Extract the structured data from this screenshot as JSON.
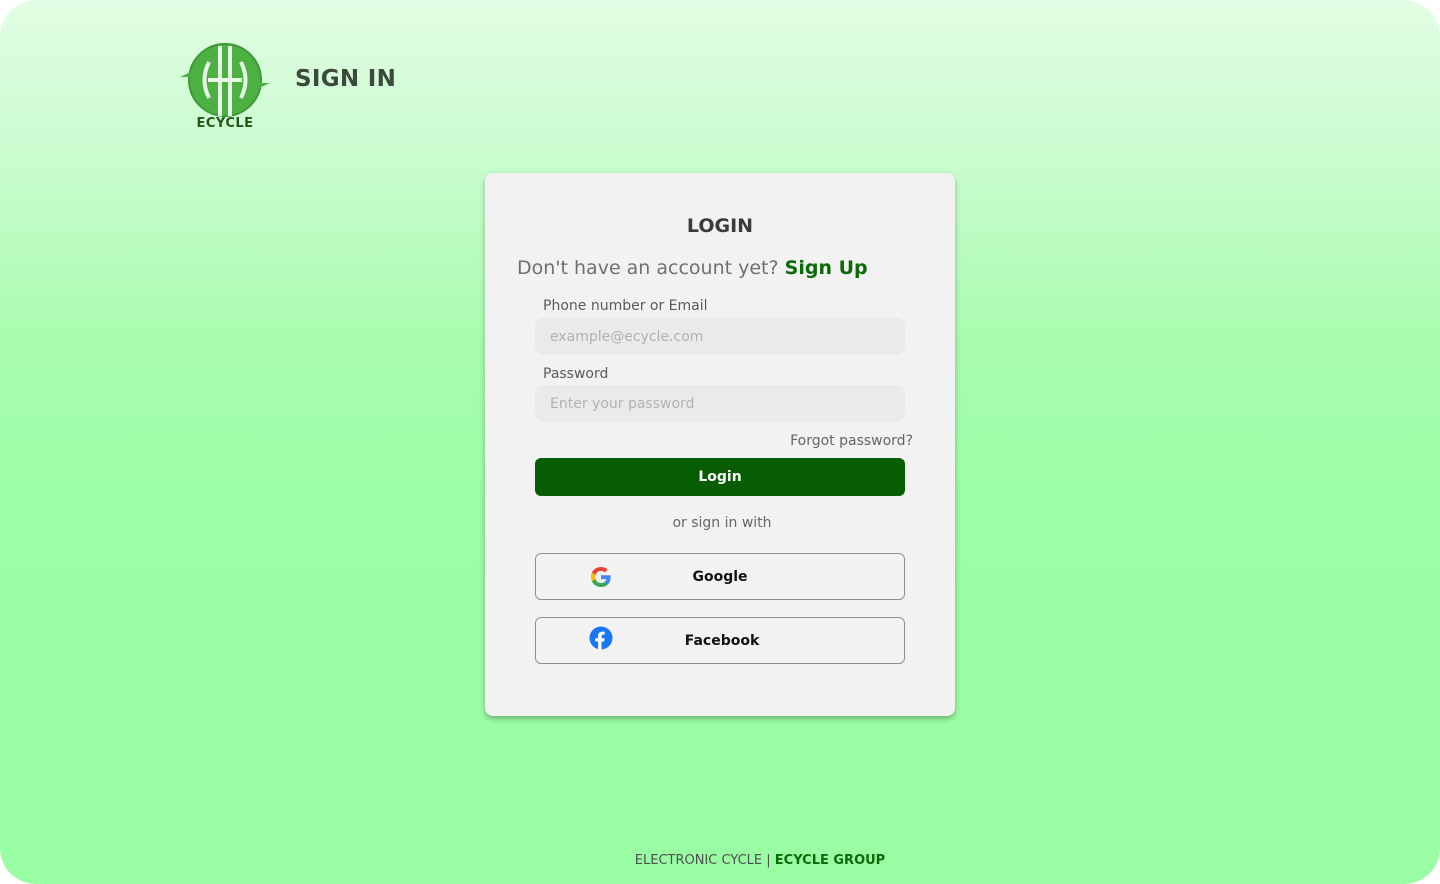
{
  "brand": {
    "logo_text": "ECYCLE",
    "logo_icon": "recycle-e-logo",
    "primary_color": "#0b6a05"
  },
  "header": {
    "title": "SIGN IN"
  },
  "login_card": {
    "title": "LOGIN",
    "signup_prompt": "Don't have an account yet?",
    "signup_link": "Sign Up",
    "email_label": "Phone number or Email",
    "email_value": "",
    "email_placeholder": "example@ecycle.com",
    "password_label": "Password",
    "password_value": "",
    "password_placeholder": "Enter your password",
    "forgot_password": "Forgot password?",
    "login_button": "Login",
    "or_text": "or sign in with",
    "google_button": "Google",
    "google_icon": "google-icon",
    "facebook_button": "Facebook",
    "facebook_icon": "facebook-icon"
  },
  "footer": {
    "left": "ELECTRONIC CYCLE",
    "separator": " | ",
    "right": "ECYCLE GROUP"
  }
}
